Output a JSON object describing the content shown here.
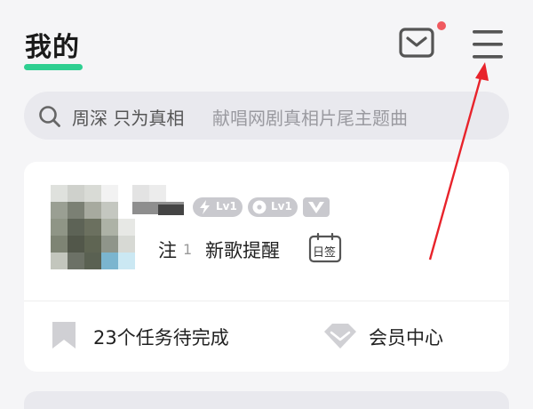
{
  "header": {
    "title": "我的",
    "accent_color": "#2ecf91",
    "notification_dot_color": "#f0595f",
    "mail_icon": "mail-icon",
    "menu_icon": "hamburger-menu-icon"
  },
  "search": {
    "icon": "search-icon",
    "keyword": "周深 只为真相",
    "hint": "献唱网剧真相片尾主题曲"
  },
  "profile": {
    "badges": [
      {
        "icon": "lightning-icon",
        "level": "Lv1"
      },
      {
        "icon": "disc-icon",
        "level": "Lv1"
      },
      {
        "icon": "vip-heart-icon",
        "level": ""
      }
    ],
    "follow_suffix": "注",
    "follow_count": "1",
    "new_song_reminder": "新歌提醒",
    "signin_label": "日签"
  },
  "shortcuts": {
    "tasks_label": "23个任务待完成",
    "tasks_icon": "bookmark-icon",
    "vip_label": "会员中心",
    "vip_icon": "diamond-icon"
  },
  "annotation": {
    "arrow_color": "#e8232b"
  }
}
